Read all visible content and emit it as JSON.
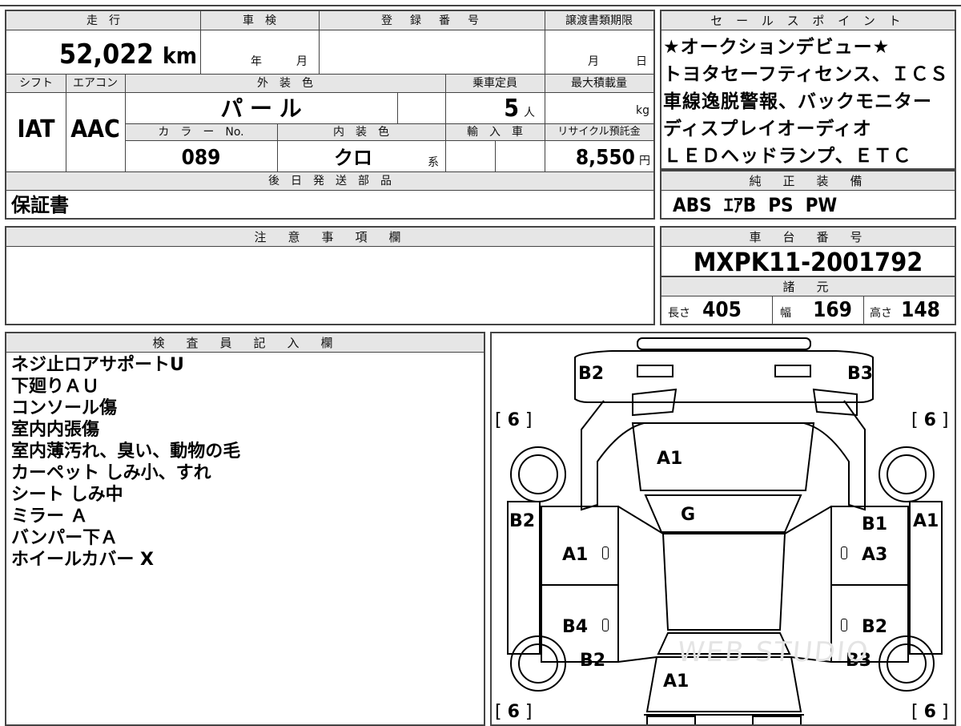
{
  "top_strip": "",
  "vehicle": {
    "mileage_header": "走　行",
    "mileage_value": "52,022",
    "mileage_unit": "km",
    "shaken_header": "車　検",
    "shaken_year": "年",
    "shaken_month": "月",
    "reg_header": "登　録　番　号",
    "doc_deadline_header": "譲渡書類期限",
    "doc_month": "月",
    "doc_day": "日",
    "shift_header": "シフト",
    "shift_value": "IAT",
    "ac_header": "エアコン",
    "ac_value": "AAC",
    "ext_color_header": "外　装　色",
    "ext_color_value": "パ ー ル",
    "capacity_header": "乗車定員",
    "capacity_value": "5",
    "capacity_unit": "人",
    "max_load_header": "最大積載量",
    "max_load_unit": "kg",
    "color_no_header": "カ　ラ　ー　No.",
    "color_no_value": "089",
    "int_color_header": "内　装　色",
    "int_color_value": "クロ",
    "int_color_unit": "系",
    "import_header": "輸　入　車",
    "recycle_header": "リサイクル預託金",
    "recycle_value": "8,550",
    "recycle_unit": "円",
    "later_parts_header": "後　日　発　送　部　品",
    "later_parts_value": "保証書"
  },
  "sales_points": {
    "header": "セ ー ル ス ポ イ ン ト",
    "lines": [
      "★オークションデビュー★",
      "トヨタセーフティセンス、ＩＣＳ",
      "車線逸脱警報、バックモニター",
      "ディスプレイオーディオ",
      "ＬＥＤヘッドランプ、ＥＴＣ"
    ]
  },
  "genuine_equipment": {
    "header": "純　正　装　備",
    "value": "ABS  ｴｱB  PS  PW"
  },
  "notes": {
    "header": "注　意　事　項　欄",
    "value": ""
  },
  "chassis": {
    "header": "車　台　番　号",
    "value": "MXPK11-2001792"
  },
  "specs": {
    "header": "諸　元",
    "length_label": "長さ",
    "length_value": "405",
    "width_label": "幅",
    "width_value": "169",
    "height_label": "高さ",
    "height_value": "148"
  },
  "inspector": {
    "header": "検　査　員　記　入　欄",
    "lines": [
      "ネジ止ロアサポートU",
      "下廻りＡＵ",
      "コンソール傷",
      "室内内張傷",
      "室内薄汚れ、臭い、動物の毛",
      "カーペット しみ小、すれ",
      "シート しみ中",
      "ミラー Ａ",
      "バンパー下Ａ",
      "ホイールカバー X"
    ]
  },
  "damage_map": {
    "labels": {
      "front_left": "B2",
      "front_right": "B3",
      "hood": "A1",
      "roof": "G",
      "left_fender": "B2",
      "right_fender_upper": "B1",
      "right_outer": "A1",
      "left_front_door": "A1",
      "right_front_door": "A3",
      "left_rear_door": "B4",
      "right_rear_door": "B2",
      "left_quarter": "B2",
      "right_quarter": "B3",
      "trunk": "A1"
    },
    "tires": {
      "front_left": "6",
      "front_right": "6",
      "rear_left": "6",
      "rear_right": "6"
    },
    "watermark": "WEB STUDIO"
  }
}
